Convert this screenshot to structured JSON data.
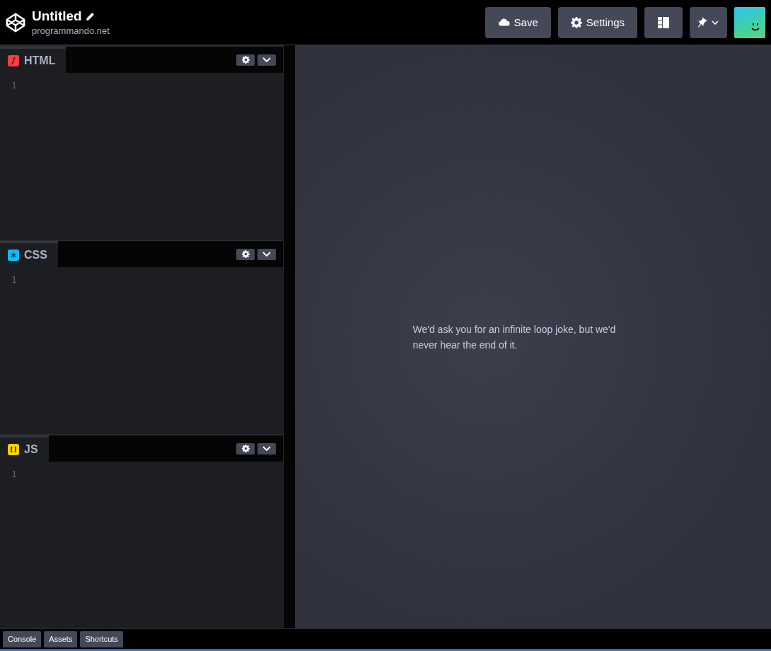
{
  "header": {
    "title": "Untitled",
    "owner": "programmando.net",
    "buttons": [
      {
        "kind": "save",
        "label": "Save"
      },
      {
        "kind": "settings",
        "label": "Settings"
      },
      {
        "kind": "layout"
      },
      {
        "kind": "pin"
      }
    ]
  },
  "editors": [
    {
      "kind": "html",
      "label": "HTML",
      "color": "#ff3c41",
      "line_number": "1"
    },
    {
      "kind": "css",
      "label": "CSS",
      "color": "#0ebeff",
      "line_number": "1"
    },
    {
      "kind": "js",
      "label": "JS",
      "color": "#fcd000",
      "line_number": "1"
    }
  ],
  "preview": {
    "message": "We'd ask you for an infinite loop joke, but we'd never hear the end of it."
  },
  "footer": {
    "buttons": [
      "Console",
      "Assets",
      "Shortcuts"
    ]
  }
}
